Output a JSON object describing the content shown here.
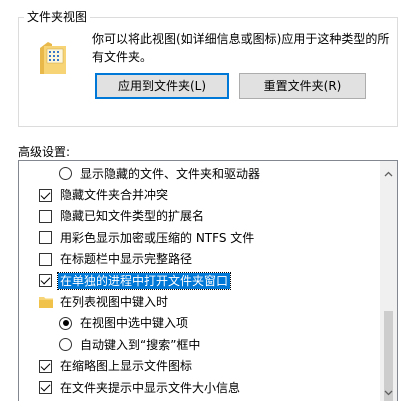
{
  "folder_view": {
    "title": "文件夹视图",
    "description": "你可以将此视图(如详细信息或图标)应用于这种类型的所有文件夹。",
    "apply_button": "应用到文件夹(L)",
    "reset_button": "重置文件夹(R)"
  },
  "advanced": {
    "label": "高级设置:",
    "items": [
      {
        "type": "radio",
        "level": 2,
        "checked": false,
        "label": "显示隐藏的文件、文件夹和驱动器"
      },
      {
        "type": "checkbox",
        "level": 1,
        "checked": true,
        "label": "隐藏文件夹合并冲突"
      },
      {
        "type": "checkbox",
        "level": 1,
        "checked": false,
        "label": "隐藏已知文件类型的扩展名"
      },
      {
        "type": "checkbox",
        "level": 1,
        "checked": false,
        "label": "用彩色显示加密或压缩的 NTFS 文件"
      },
      {
        "type": "checkbox",
        "level": 1,
        "checked": false,
        "label": "在标题栏中显示完整路径"
      },
      {
        "type": "checkbox",
        "level": 1,
        "checked": true,
        "selected": true,
        "label": "在单独的进程中打开文件夹窗口"
      },
      {
        "type": "folder",
        "level": 1,
        "label": "在列表视图中键入时"
      },
      {
        "type": "radio",
        "level": 2,
        "checked": true,
        "label": "在视图中选中键入项"
      },
      {
        "type": "radio",
        "level": 2,
        "checked": false,
        "label": "自动键入到“搜索”框中"
      },
      {
        "type": "checkbox",
        "level": 1,
        "checked": true,
        "label": "在缩略图上显示文件图标"
      },
      {
        "type": "checkbox",
        "level": 1,
        "checked": true,
        "label": "在文件夹提示中显示文件大小信息"
      },
      {
        "type": "checkbox",
        "level": 1,
        "checked": true,
        "label": "在预览窗格中显示预览控件"
      }
    ]
  },
  "colors": {
    "selection": "#0078d7",
    "button_face": "#e1e1e1",
    "folder": "#f7d576"
  },
  "icons": {
    "folder_large": "folder-with-grid-icon",
    "scroll_up": "chevron-up-icon",
    "scroll_down": "chevron-down-icon"
  }
}
